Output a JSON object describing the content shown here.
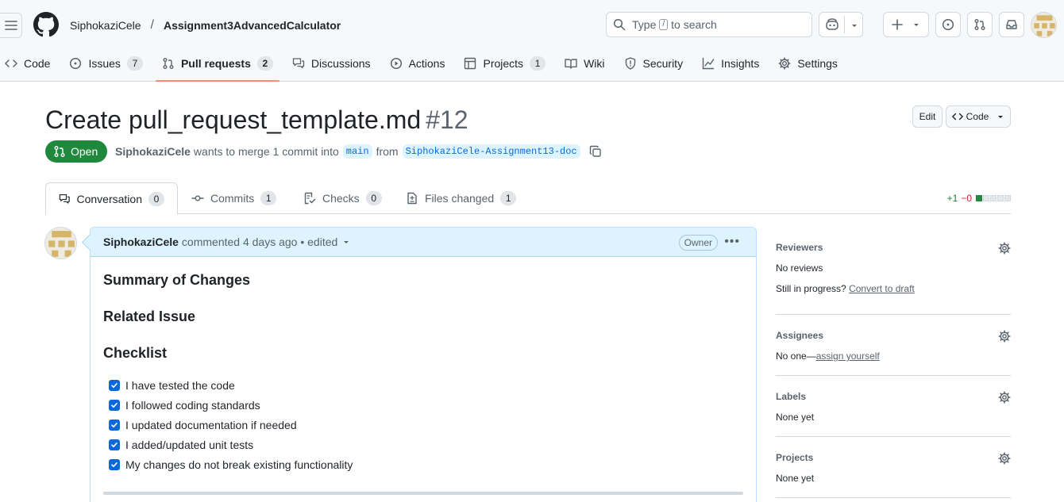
{
  "header": {
    "owner": "SiphokaziCele",
    "separator": "/",
    "repo": "Assignment3AdvancedCalculator",
    "search_prefix": "Type",
    "search_key": "/",
    "search_suffix": "to search"
  },
  "repo_tabs": [
    {
      "label": "Code",
      "icon": "code-icon"
    },
    {
      "label": "Issues",
      "count": "7",
      "icon": "issue-opened-icon"
    },
    {
      "label": "Pull requests",
      "count": "2",
      "icon": "git-pull-request-icon",
      "active": true
    },
    {
      "label": "Discussions",
      "icon": "comment-discussion-icon"
    },
    {
      "label": "Actions",
      "icon": "play-icon"
    },
    {
      "label": "Projects",
      "count": "1",
      "icon": "table-icon"
    },
    {
      "label": "Wiki",
      "icon": "book-icon"
    },
    {
      "label": "Security",
      "icon": "shield-icon"
    },
    {
      "label": "Insights",
      "icon": "graph-icon"
    },
    {
      "label": "Settings",
      "icon": "gear-icon"
    }
  ],
  "pr": {
    "title": "Create pull_request_template.md",
    "number": "#12",
    "edit_label": "Edit",
    "code_label": "Code",
    "state": "Open",
    "author": "SiphokaziCele",
    "merge_text": "wants to merge 1 commit into",
    "base_branch": "main",
    "from_text": "from",
    "head_branch": "SiphokaziCele-Assignment13-doc"
  },
  "pr_tabs": [
    {
      "label": "Conversation",
      "count": "0",
      "active": true
    },
    {
      "label": "Commits",
      "count": "1"
    },
    {
      "label": "Checks",
      "count": "0"
    },
    {
      "label": "Files changed",
      "count": "1"
    }
  ],
  "diffstat": {
    "additions": "+1",
    "deletions": "−0"
  },
  "comment": {
    "author": "SiphokaziCele",
    "meta": "commented 4 days ago • edited",
    "badge": "Owner",
    "heading1": "Summary of Changes",
    "heading2": "Related Issue",
    "heading3": "Checklist",
    "checklist": [
      "I have tested the code",
      "I followed coding standards",
      "I updated documentation if needed",
      "I added/updated unit tests",
      "My changes do not break existing functionality"
    ]
  },
  "sidebar": {
    "reviewers_title": "Reviewers",
    "reviewers_value": "No reviews",
    "in_progress_text": "Still in progress?",
    "convert_link": "Convert to draft",
    "assignees_title": "Assignees",
    "assignees_prefix": "No one—",
    "assign_link": "assign yourself",
    "labels_title": "Labels",
    "labels_value": "None yet",
    "projects_title": "Projects",
    "projects_value": "None yet"
  },
  "colors": {
    "open_green": "#1f883d",
    "active_tab_underline": "#fd8c73",
    "comment_header_bg": "#ddf4ff",
    "link_blue": "#0969da"
  }
}
